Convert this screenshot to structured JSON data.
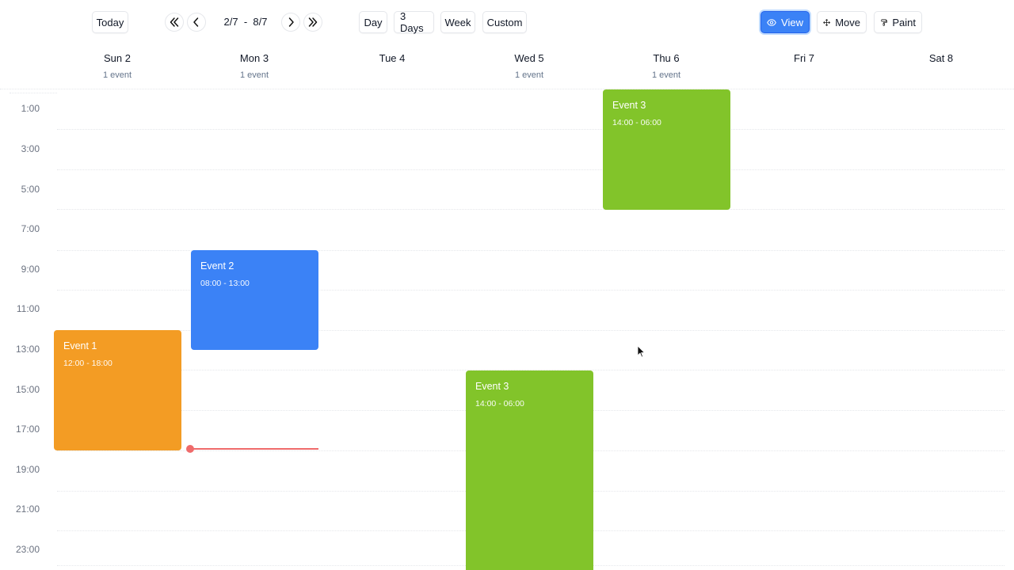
{
  "toolbar": {
    "today_label": "Today",
    "range_label": "2/7  -  8/7",
    "views": {
      "day": "Day",
      "three_days": "3 Days",
      "week": "Week",
      "custom": "Custom"
    },
    "modes": {
      "view": "View",
      "move": "Move",
      "paint": "Paint"
    },
    "active_mode": "view"
  },
  "days": [
    {
      "name": "Sun 2",
      "count": "1 event"
    },
    {
      "name": "Mon 3",
      "count": "1 event"
    },
    {
      "name": "Tue 4",
      "count": ""
    },
    {
      "name": "Wed 5",
      "count": "1 event"
    },
    {
      "name": "Thu 6",
      "count": "1 event"
    },
    {
      "name": "Fri 7",
      "count": ""
    },
    {
      "name": "Sat 8",
      "count": ""
    }
  ],
  "time_labels": [
    "1:00",
    "3:00",
    "5:00",
    "7:00",
    "9:00",
    "11:00",
    "13:00",
    "15:00",
    "17:00",
    "19:00",
    "21:00",
    "23:00"
  ],
  "events": [
    {
      "title": "Event 1",
      "time": "12:00 - 18:00",
      "color": "#f39c24"
    },
    {
      "title": "Event 2",
      "time": "08:00 - 13:00",
      "color": "#3b82f6"
    },
    {
      "title": "Event 3",
      "time": "14:00 - 06:00",
      "color": "#82c42a"
    },
    {
      "title": "Event 3",
      "time": "14:00 - 06:00",
      "color": "#82c42a"
    }
  ],
  "colors": {
    "accent": "#3b82f6",
    "now_indicator": "#ef6b6b"
  }
}
